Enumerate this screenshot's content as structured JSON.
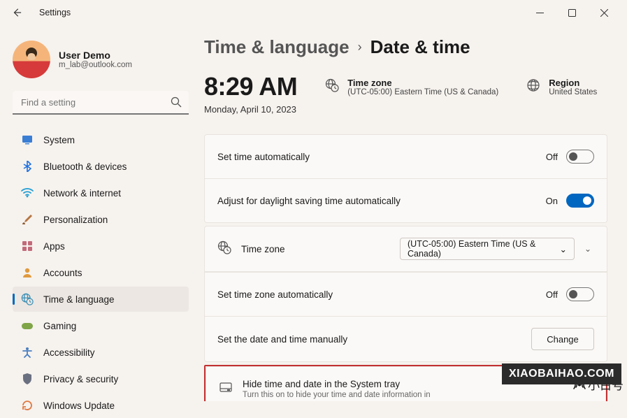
{
  "window": {
    "title": "Settings"
  },
  "sidebar": {
    "user": {
      "name": "User Demo",
      "email": "m_lab@outlook.com"
    },
    "search": {
      "placeholder": "Find a setting"
    },
    "items": [
      {
        "name": "system",
        "label": "System",
        "icon": "display-icon",
        "color": "#3a7ed4"
      },
      {
        "name": "bluetooth",
        "label": "Bluetooth & devices",
        "icon": "bluetooth-icon",
        "color": "#1d6fe0"
      },
      {
        "name": "network",
        "label": "Network & internet",
        "icon": "wifi-icon",
        "color": "#28a0d4"
      },
      {
        "name": "personalization",
        "label": "Personalization",
        "icon": "brush-icon",
        "color": "#b57540"
      },
      {
        "name": "apps",
        "label": "Apps",
        "icon": "apps-icon",
        "color": "#c26a7a"
      },
      {
        "name": "accounts",
        "label": "Accounts",
        "icon": "person-icon",
        "color": "#e09a3e"
      },
      {
        "name": "time-language",
        "label": "Time & language",
        "icon": "globe-clock-icon",
        "color": "#3a8fb5",
        "active": true
      },
      {
        "name": "gaming",
        "label": "Gaming",
        "icon": "gamepad-icon",
        "color": "#7fa548"
      },
      {
        "name": "accessibility",
        "label": "Accessibility",
        "icon": "accessibility-icon",
        "color": "#4a7fc0"
      },
      {
        "name": "privacy",
        "label": "Privacy & security",
        "icon": "shield-icon",
        "color": "#6a7080"
      },
      {
        "name": "windows-update",
        "label": "Windows Update",
        "icon": "update-icon",
        "color": "#e07840"
      }
    ]
  },
  "breadcrumb": {
    "parent": "Time & language",
    "current": "Date & time"
  },
  "clock": {
    "time": "8:29 AM",
    "date": "Monday, April 10, 2023"
  },
  "info_blocks": {
    "timezone": {
      "title": "Time zone",
      "value": "(UTC-05:00) Eastern Time (US & Canada)"
    },
    "region": {
      "title": "Region",
      "value": "United States"
    }
  },
  "settings": {
    "auto_time": {
      "label": "Set time automatically",
      "state": "Off",
      "on": false
    },
    "dst": {
      "label": "Adjust for daylight saving time automatically",
      "state": "On",
      "on": true
    },
    "timezone_row": {
      "label": "Time zone",
      "value": "(UTC-05:00) Eastern Time (US & Canada)"
    },
    "auto_tz": {
      "label": "Set time zone automatically",
      "state": "Off",
      "on": false
    },
    "manual": {
      "label": "Set the date and time manually",
      "button": "Change"
    },
    "hide_tray": {
      "label": "Hide time and date in the System tray",
      "sub": "Turn this on to hide your time and date information in"
    }
  },
  "watermark": {
    "cn": "小白号",
    "domain": "XIAOBAIHAO.COM"
  }
}
